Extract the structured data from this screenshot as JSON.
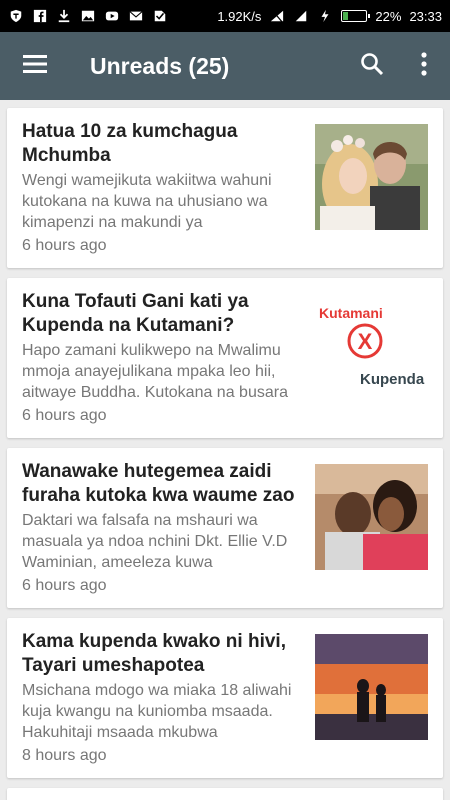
{
  "status_bar": {
    "speed": "1.92K/s",
    "battery_percent": "22%",
    "time": "23:33",
    "battery_level": 0.22,
    "left_icons": [
      "shield-icon",
      "facebook-icon",
      "download-icon",
      "image-icon",
      "youtube-icon",
      "mail-icon",
      "check-icon"
    ]
  },
  "app_bar": {
    "title": "Unreads (25)",
    "menu_icon": "hamburger-menu-icon",
    "search_icon": "search-icon",
    "overflow_icon": "more-vert-icon",
    "color": "#4b5d66"
  },
  "articles": [
    {
      "title": "Hatua 10 za kumchagua Mchumba",
      "excerpt": "Wengi wamejikuta wakiitwa wahuni kutokana na kuwa na uhusiano wa kimapenzi na makundi ya",
      "time": "6 hours ago",
      "thumbnail": "couple-photo"
    },
    {
      "title": "Kuna Tofauti Gani kati ya Kupenda na Kutamani?",
      "excerpt": "Hapo zamani kulikwepo na Mwalimu mmoja anayejulikana mpaka leo hii, aitwaye Buddha. Kutokana na busara",
      "time": "6 hours ago",
      "thumbnail": "text-graphic",
      "graphic": {
        "top_word": "Kutamani",
        "symbol": "X",
        "bottom_word": "Kupenda"
      }
    },
    {
      "title": "Wanawake hutegemea zaidi furaha kutoka kwa waume zao",
      "excerpt": "Daktari wa falsafa na mshauri wa masuala ya ndoa nchini Dkt. Ellie V.D Waminian, ameeleza kuwa",
      "time": "6 hours ago",
      "thumbnail": "smiling-couple-photo"
    },
    {
      "title": "Kama kupenda kwako ni hivi, Tayari umeshapotea",
      "excerpt": "Msichana mdogo wa miaka 18 aliwahi kuja kwangu na kuniomba msaada. Hakuhitaji msaada mkubwa",
      "time": "8 hours ago",
      "thumbnail": "sunset-silhouette-photo"
    }
  ]
}
